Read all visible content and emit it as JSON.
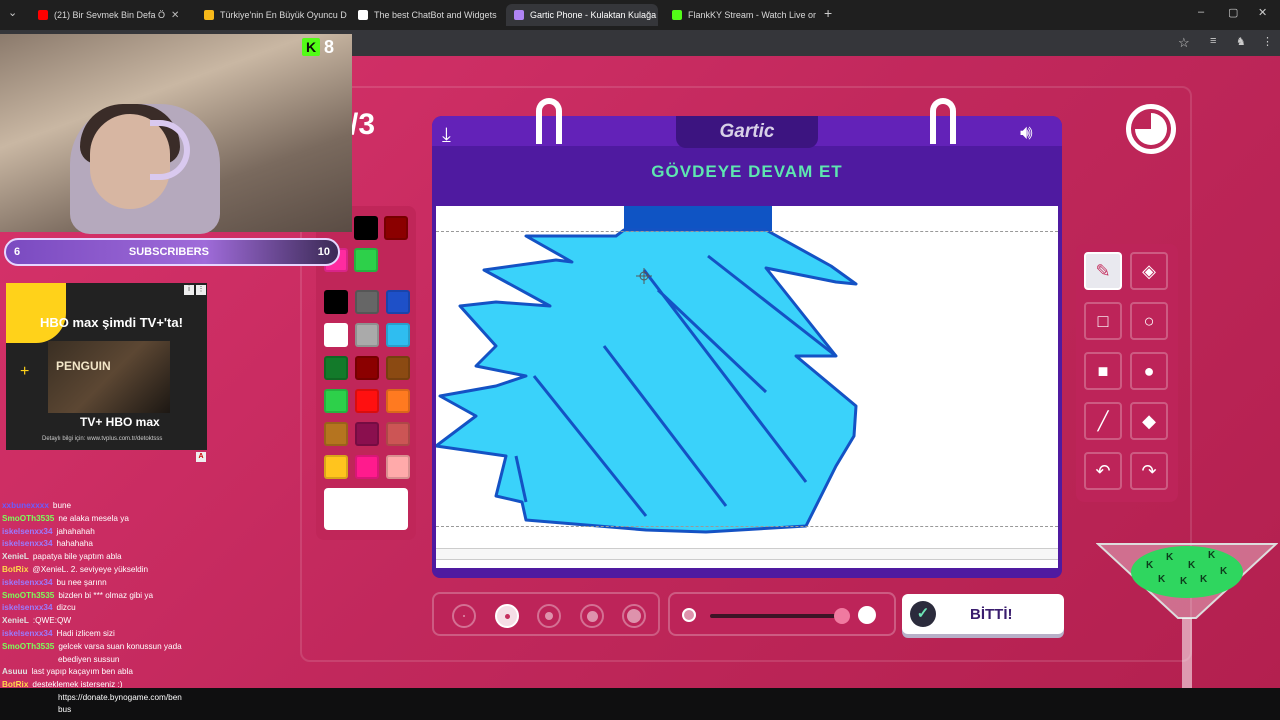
{
  "browser": {
    "tabs": [
      {
        "title": "(21) Bir Sevmek Bin Defa Ö",
        "icon": "youtube-icon",
        "color": "#ff0000"
      },
      {
        "title": "Türkiye'nin En Büyük Oyuncu D",
        "icon": "trophy-icon",
        "color": "#f6b81a"
      },
      {
        "title": "The best ChatBot and Widgets",
        "icon": "diamond-icon",
        "color": "#ffffff"
      },
      {
        "title": "Gartic Phone - Kulaktan Kulağa",
        "icon": "phone-icon",
        "color": "#b084f5",
        "active": true
      },
      {
        "title": "FlankKY Stream - Watch Live or",
        "icon": "kick-icon",
        "color": "#53fc18"
      }
    ],
    "new_tab": "+",
    "window_controls": [
      "–",
      "▢",
      "✕"
    ]
  },
  "stream": {
    "kick_letter": "K",
    "viewer_count": "8",
    "subscribers": {
      "left": "6",
      "label": "SUBSCRIBERS",
      "right": "10",
      "progress": 0.6
    }
  },
  "ad": {
    "brand": "HBO max",
    "headline": "şimdi TV+'ta!",
    "movie": "PENGUIN",
    "footer_logo": "TV+ HBO max",
    "disclaimer": "Detaylı bilgi için: www.tvplus.com.tr/detoktsss",
    "badge": "A"
  },
  "chat": [
    {
      "user": "xxbunexxxx",
      "color": "#6b5cff",
      "text": "bune"
    },
    {
      "user": "SmoOTh3535",
      "color": "#7cff5a",
      "text": "ne alaka mesela ya"
    },
    {
      "user": "iskelsenxx34",
      "color": "#9a7bff",
      "text": "jahahahah"
    },
    {
      "user": "iskelsenxx34",
      "color": "#9a7bff",
      "text": "hahahaha"
    },
    {
      "user": "XenieL",
      "color": "#e0e0e0",
      "text": "papatya bile yaptım abla"
    },
    {
      "user": "BotRix",
      "color": "#ffd84a",
      "text": "@XenieL. 2. seviyeye yükseldin"
    },
    {
      "user": "iskelsenxx34",
      "color": "#9a7bff",
      "text": "bu nee şarınn"
    },
    {
      "user": "SmoOTh3535",
      "color": "#7cff5a",
      "text": "bizden bi *** olmaz gibi ya"
    },
    {
      "user": "iskelsenxx34",
      "color": "#9a7bff",
      "text": "dizcu"
    },
    {
      "user": "XenieL",
      "color": "#e0e0e0",
      "text": ":QWE:QW"
    },
    {
      "user": "iskelsenxx34",
      "color": "#9a7bff",
      "text": "Hadi izlicem sizi"
    },
    {
      "user": "SmoOTh3535",
      "color": "#7cff5a",
      "text": "gelcek varsa suan konussun yada"
    },
    {
      "user": "",
      "color": "#ffffff",
      "text": "ebediyen sussun"
    },
    {
      "user": "Asuuu",
      "color": "#e0e0e0",
      "text": "last yapıp kaçayım ben abla"
    },
    {
      "user": "BotRix",
      "color": "#ffd84a",
      "text": "desteklemek isterseniz :)"
    }
  ],
  "donate": {
    "line1": "https://donate.bynogame.com/ben",
    "line2": "bus"
  },
  "game": {
    "round": "/3",
    "logo": "Gartic",
    "prompt": "GÖVDEYE DEVAM ET",
    "done_button": "BİTTİ!",
    "timer_remaining": 0.75,
    "selected_tool": "pencil",
    "selected_size_index": 1,
    "selected_color": "#ffffff",
    "palette": [
      "#000000",
      "#666666",
      "#1e50c8",
      "#ffffff",
      "#aaaaaa",
      "#2fbdf0",
      "#137a2a",
      "#8b0000",
      "#8b4a12",
      "#2dd04a",
      "#ff1010",
      "#ff7a20",
      "#b5741f",
      "#8a0f4e",
      "#cc5555",
      "#ffc41e",
      "#ff1b8d",
      "#ffaaaa"
    ],
    "palette_top": [
      "#000000",
      "#8b0000",
      "#ff2ba0",
      "#2dd04a"
    ],
    "opacity_value": 1
  },
  "tools": [
    {
      "name": "pencil-tool",
      "glyph": "✎"
    },
    {
      "name": "eraser-tool",
      "glyph": "◈"
    },
    {
      "name": "rectangle-outline-tool",
      "glyph": "□"
    },
    {
      "name": "ellipse-outline-tool",
      "glyph": "○"
    },
    {
      "name": "rectangle-fill-tool",
      "glyph": "■"
    },
    {
      "name": "ellipse-fill-tool",
      "glyph": "●"
    },
    {
      "name": "line-tool",
      "glyph": "╱"
    },
    {
      "name": "bucket-tool",
      "glyph": "◆"
    },
    {
      "name": "undo-tool",
      "glyph": "↶"
    },
    {
      "name": "redo-tool",
      "glyph": "↷"
    }
  ]
}
